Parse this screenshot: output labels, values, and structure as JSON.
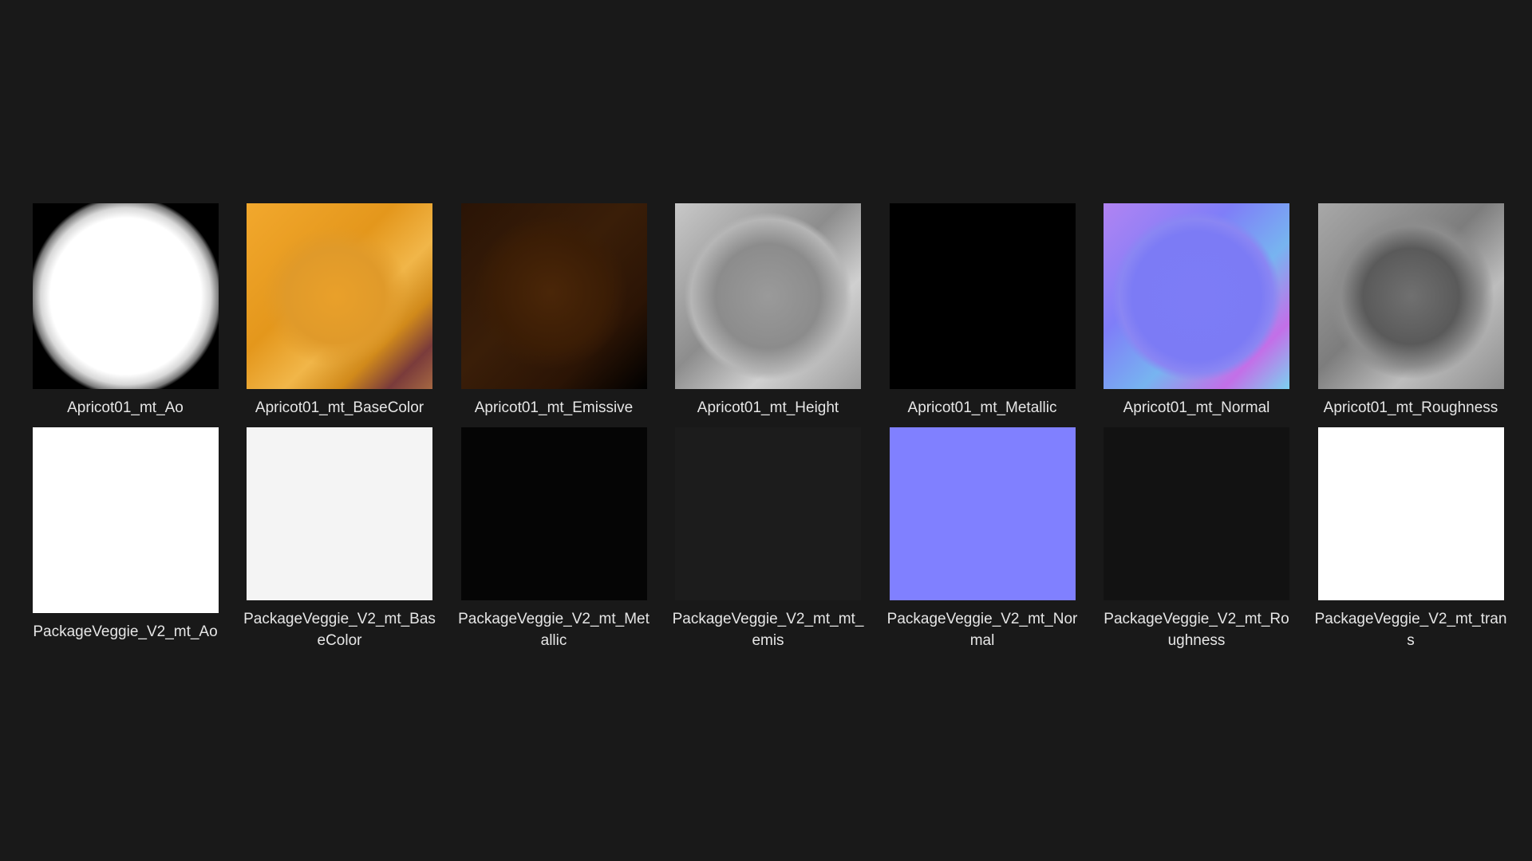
{
  "files": [
    {
      "label": "Apricot01_mt_Ao",
      "texture": "ao-map-apricot"
    },
    {
      "label": "Apricot01_mt_BaseColor",
      "texture": "basecolor-map-apricot"
    },
    {
      "label": "Apricot01_mt_Emissive",
      "texture": "emissive-map-apricot"
    },
    {
      "label": "Apricot01_mt_Height",
      "texture": "height-map-apricot"
    },
    {
      "label": "Apricot01_mt_Metallic",
      "texture": "metallic-map-apricot"
    },
    {
      "label": "Apricot01_mt_Normal",
      "texture": "normal-map-apricot"
    },
    {
      "label": "Apricot01_mt_Roughness",
      "texture": "roughness-map-apricot"
    },
    {
      "label": "PackageVeggie_V2_mt_Ao",
      "texture": "ao-map-package"
    },
    {
      "label": "PackageVeggie_V2_mt_BaseColor",
      "texture": "basecolor-map-package"
    },
    {
      "label": "PackageVeggie_V2_mt_Metallic",
      "texture": "metallic-map-package"
    },
    {
      "label": "PackageVeggie_V2_mt_mt_emis",
      "texture": "emissive-map-package"
    },
    {
      "label": "PackageVeggie_V2_mt_Normal",
      "texture": "normal-map-package"
    },
    {
      "label": "PackageVeggie_V2_mt_Roughness",
      "texture": "roughness-map-package"
    },
    {
      "label": "PackageVeggie_V2_mt_trans",
      "texture": "transparency-map-package"
    }
  ],
  "colors": {
    "background": "#191919",
    "label_text": "#e6e6e6",
    "normal_flat": "#8080ff"
  }
}
